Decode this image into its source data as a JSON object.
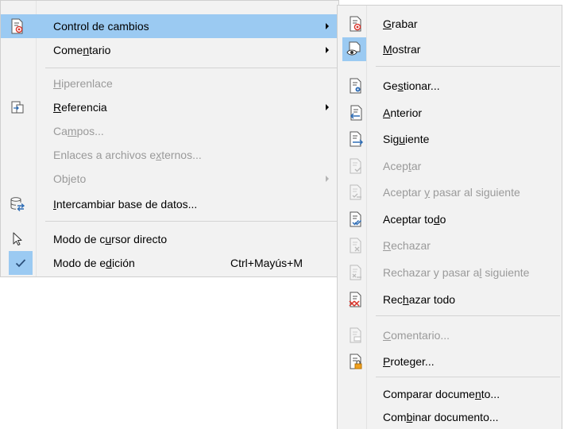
{
  "main_menu": {
    "items": [
      {
        "pre": "",
        "ul": "",
        "post": "Control de cambios"
      },
      {
        "pre": "Come",
        "ul": "n",
        "post": "tario"
      },
      {
        "pre": "",
        "ul": "H",
        "post": "iperenlace"
      },
      {
        "pre": "",
        "ul": "R",
        "post": "eferencia"
      },
      {
        "pre": "Ca",
        "ul": "m",
        "post": "pos..."
      },
      {
        "pre": "Enlaces a archivos e",
        "ul": "x",
        "post": "ternos..."
      },
      {
        "pre": "Objeto",
        "ul": "",
        "post": ""
      },
      {
        "pre": "",
        "ul": "I",
        "post": "ntercambiar base de datos..."
      },
      {
        "pre": "Modo de c",
        "ul": "u",
        "post": "rsor directo"
      },
      {
        "pre": "Modo de e",
        "ul": "d",
        "post": "ición"
      }
    ],
    "edit_mode_shortcut": "Ctrl+Mayús+M"
  },
  "sub_menu": {
    "items": [
      {
        "pre": "",
        "ul": "G",
        "post": "rabar"
      },
      {
        "pre": "",
        "ul": "M",
        "post": "ostrar"
      },
      {
        "pre": "Ge",
        "ul": "s",
        "post": "tionar..."
      },
      {
        "pre": "",
        "ul": "A",
        "post": "nterior"
      },
      {
        "pre": "Sig",
        "ul": "u",
        "post": "iente"
      },
      {
        "pre": "Acep",
        "ul": "t",
        "post": "ar"
      },
      {
        "pre": "Aceptar ",
        "ul": "y",
        "post": " pasar al siguiente"
      },
      {
        "pre": "Aceptar to",
        "ul": "d",
        "post": "o"
      },
      {
        "pre": "",
        "ul": "R",
        "post": "echazar"
      },
      {
        "pre": "Rechazar y pasar a",
        "ul": "l",
        "post": " siguiente"
      },
      {
        "pre": "Rec",
        "ul": "h",
        "post": "azar todo"
      },
      {
        "pre": "",
        "ul": "C",
        "post": "omentario..."
      },
      {
        "pre": "",
        "ul": "P",
        "post": "roteger..."
      },
      {
        "pre": "Comparar docume",
        "ul": "n",
        "post": "to..."
      },
      {
        "pre": "Com",
        "ul": "b",
        "post": "inar documento..."
      }
    ]
  },
  "colors": {
    "highlight": "#9bcaf2",
    "menu_bg": "#f2f2f2",
    "disabled_text": "#9a9a9a",
    "accent_blue": "#2f6db5",
    "accent_red": "#d9342b",
    "accent_orange": "#f0a020"
  }
}
